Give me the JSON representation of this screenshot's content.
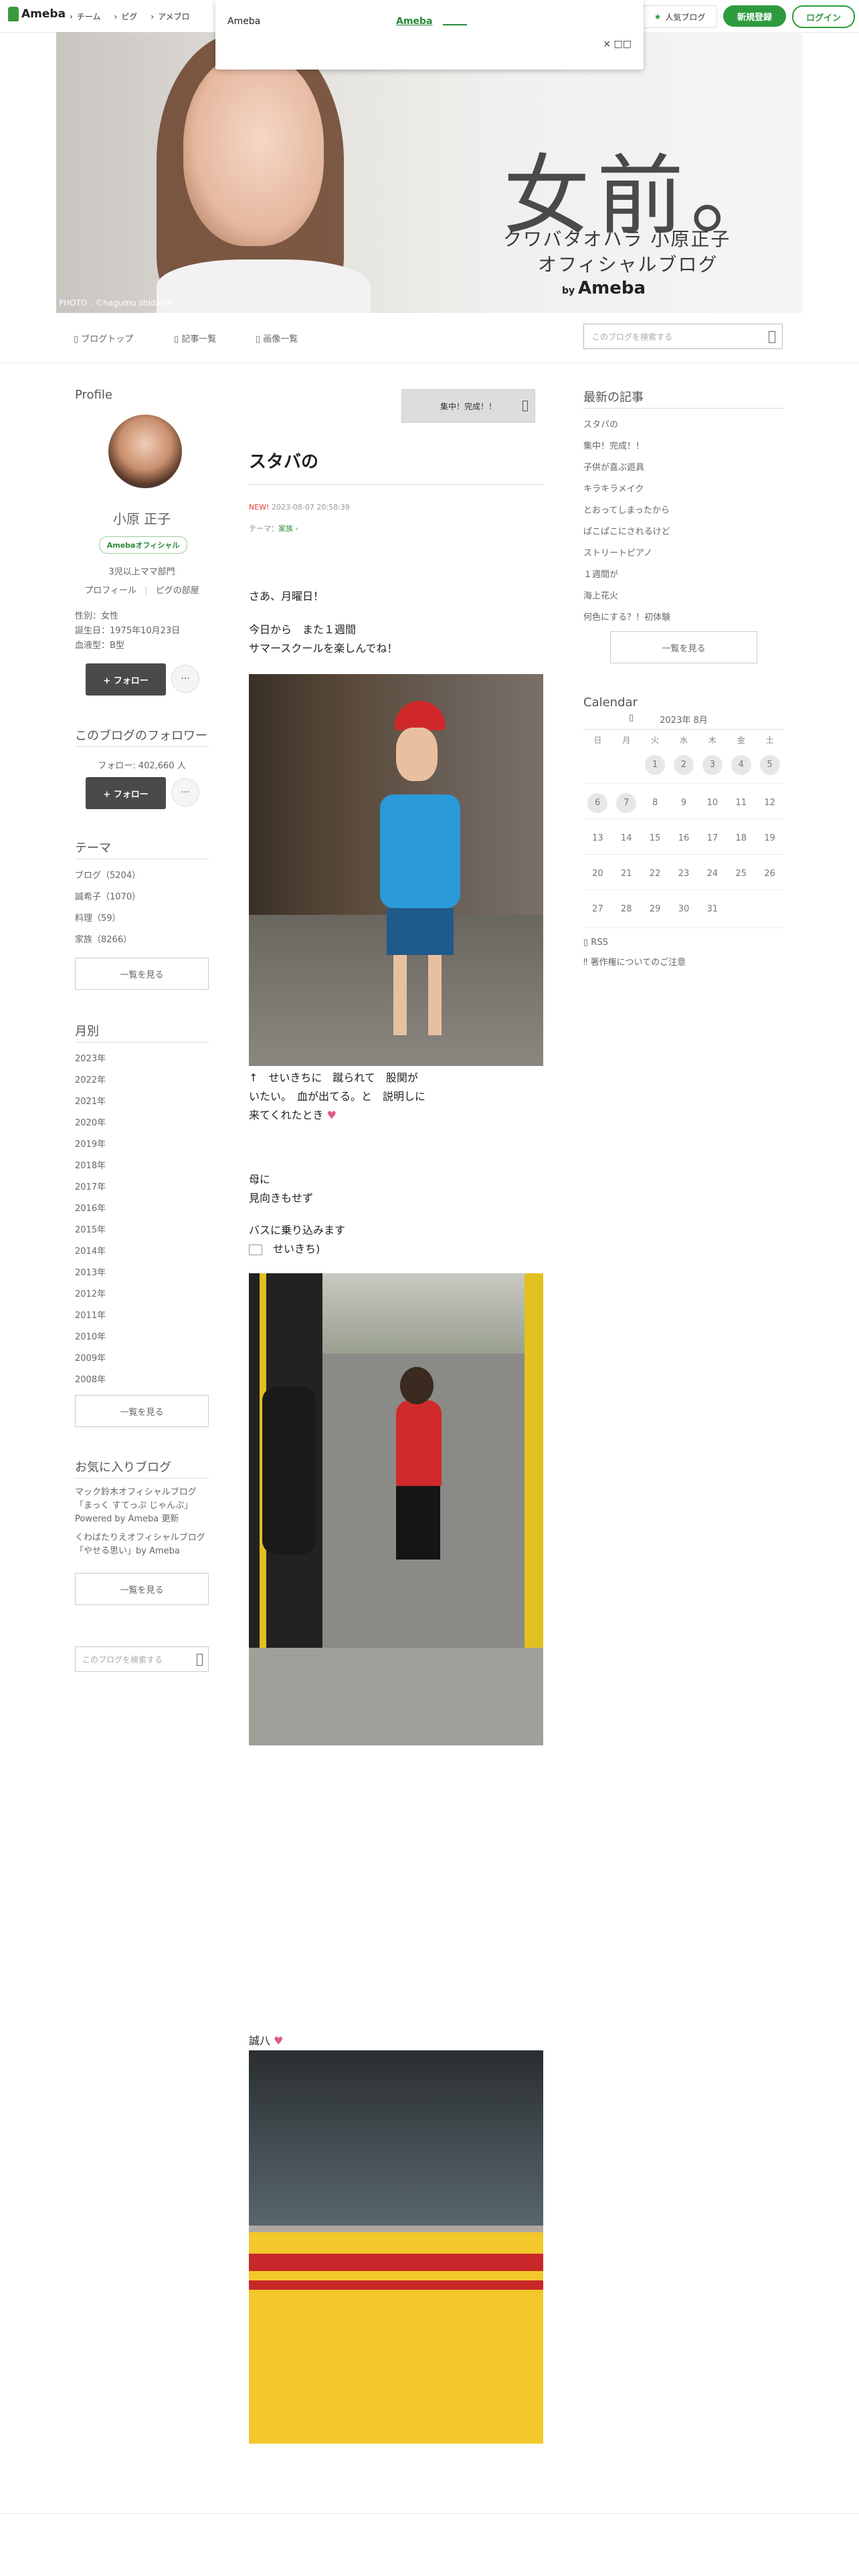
{
  "topnav": {
    "logo": "Ameba",
    "links": [
      "チーム",
      "ピグ",
      "アメブロ"
    ],
    "popular": "人気ブログ",
    "signup": "新規登録",
    "login": "ログイン"
  },
  "popup": {
    "title": "Ameba",
    "link": "Ameba",
    "close": "× □□"
  },
  "banner": {
    "title": "女前。",
    "sub1": "クワバタオハラ 小原正子",
    "sub2": "オフィシャルブログ",
    "by": "by",
    "brand": "Ameba",
    "photo_credit": "PHOTO : ©hagumu shidachi"
  },
  "blognav": {
    "top": "ブログトップ",
    "articles": "記事一覧",
    "images": "画像一覧",
    "search_placeholder": "このブログを検索する"
  },
  "profile": {
    "heading": "Profile",
    "name": "小原 正子",
    "badge": "Amebaオフィシャル",
    "rank": "3児以上ママ部門",
    "links": [
      "プロフィール",
      "ピグの部屋"
    ],
    "gender": "性別：女性",
    "birthday": "誕生日：1975年10月23日",
    "blood": "血液型：B型",
    "follow": "+ フォロー",
    "dots": "···"
  },
  "followers": {
    "heading": "このブログのフォロワー",
    "count_label": "フォロー: 402,660 人",
    "follow": "+ フォロー",
    "dots": "···"
  },
  "themes": {
    "heading": "テーマ",
    "items": [
      "ブログ（5204）",
      "誠希子（1070）",
      "料理（59）",
      "家族（8266）"
    ],
    "more": "一覧を見る"
  },
  "monthly": {
    "heading": "月別",
    "items": [
      "2023年",
      "2022年",
      "2021年",
      "2020年",
      "2019年",
      "2018年",
      "2017年",
      "2016年",
      "2015年",
      "2014年",
      "2013年",
      "2012年",
      "2011年",
      "2010年",
      "2009年",
      "2008年"
    ],
    "more": "一覧を見る"
  },
  "favorites": {
    "heading": "お気に入りブログ",
    "items": [
      "マック鈴木オフィシャルブログ「まっく すてっぷ じゃんぷ」Powered by Ameba 更新",
      "くわばたりえオフィシャルブログ「やせる思い」by Ameba"
    ],
    "more": "一覧を見る",
    "search_placeholder": "このブログを検索する"
  },
  "article": {
    "top_button": "集中！完成！！",
    "title": "スタバの",
    "new_tag": "NEW!",
    "date": "2023-08-07 20:58:39",
    "theme_label": "テーマ：",
    "theme": "家族",
    "p1": "さあ、月曜日！",
    "p2a": "今日から　また１週間",
    "p2b": "サマースクールを楽しんでね！",
    "cap1a": "↑　せいきちに　蹴られて　股関が",
    "cap1b": "いたい。　血が出てる。と　説明しに",
    "cap1c": "来てくれたとき",
    "p3a": "母に",
    "p3b": "見向きもせず",
    "p4": "バスに乗り込みます",
    "p5": "せいきち)",
    "p6": "誠八"
  },
  "recent": {
    "heading": "最新の記事",
    "items": [
      "スタバの",
      "集中！完成！！",
      "子供が喜ぶ遊具",
      "キラキラメイク",
      "とおってしまったから",
      "ぱこぱこにされるけど",
      "ストリートピアノ",
      "１週間が",
      "海上花火",
      "何色にする？！初体験"
    ],
    "more": "一覧を見る"
  },
  "calendar": {
    "heading": "Calendar",
    "month": "2023年 8月",
    "weekdays": [
      "日",
      "月",
      "火",
      "水",
      "木",
      "金",
      "土"
    ],
    "weeks": [
      [
        "",
        "",
        "1",
        "2",
        "3",
        "4",
        "5"
      ],
      [
        "6",
        "7",
        "8",
        "9",
        "10",
        "11",
        "12"
      ],
      [
        "13",
        "14",
        "15",
        "16",
        "17",
        "18",
        "19"
      ],
      [
        "20",
        "21",
        "22",
        "23",
        "24",
        "25",
        "26"
      ],
      [
        "27",
        "28",
        "29",
        "30",
        "31",
        "",
        ""
      ]
    ]
  },
  "footer_links": {
    "rss": "RSS",
    "copyright": "著作権についてのご注意"
  },
  "colors": {
    "accent": "#2e9a3e",
    "dark_button": "#4a4a4a"
  }
}
